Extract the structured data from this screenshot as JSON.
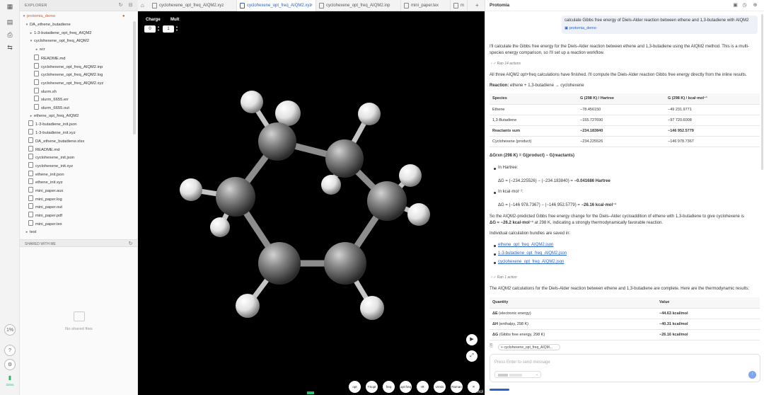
{
  "rail": {
    "progress_label": "1%",
    "time_label": "22ms"
  },
  "explorer": {
    "title": "EXPLORER",
    "root": "protomia_demo",
    "items": [
      {
        "label": "DA_ethene_butadiene",
        "depth": 1,
        "kind": "folder-open"
      },
      {
        "label": "1-3-butadiene_opt_freq_AIQM2",
        "depth": 2,
        "kind": "folder"
      },
      {
        "label": "cyclohexene_opt_freq_AIQM2",
        "depth": 2,
        "kind": "folder-open"
      },
      {
        "label": "scr",
        "depth": 3,
        "kind": "folder"
      },
      {
        "label": "README.md",
        "depth": 3,
        "kind": "file"
      },
      {
        "label": "cyclohexene_opt_freq_AIQM2.inp",
        "depth": 3,
        "kind": "file"
      },
      {
        "label": "cyclohexene_opt_freq_AIQM2.log",
        "depth": 3,
        "kind": "file"
      },
      {
        "label": "cyclohexene_opt_freq_AIQM2.xyz",
        "depth": 3,
        "kind": "file"
      },
      {
        "label": "slurm.sh",
        "depth": 3,
        "kind": "file"
      },
      {
        "label": "slurm_6655.err",
        "depth": 3,
        "kind": "file"
      },
      {
        "label": "slurm_6655.out",
        "depth": 3,
        "kind": "file"
      },
      {
        "label": "ethene_opt_freq_AIQM2",
        "depth": 2,
        "kind": "folder"
      },
      {
        "label": "1-3-butadiene_init.json",
        "depth": 2,
        "kind": "file"
      },
      {
        "label": "1-3-butadiene_init.xyz",
        "depth": 2,
        "kind": "file"
      },
      {
        "label": "DA_ethene_butadiene.xlsx",
        "depth": 2,
        "kind": "file"
      },
      {
        "label": "README.md",
        "depth": 2,
        "kind": "file"
      },
      {
        "label": "cyclohexene_init.json",
        "depth": 2,
        "kind": "file"
      },
      {
        "label": "cyclohexene_init.xyz",
        "depth": 2,
        "kind": "file"
      },
      {
        "label": "ethene_init.json",
        "depth": 2,
        "kind": "file"
      },
      {
        "label": "ethene_init.xyz",
        "depth": 2,
        "kind": "file"
      },
      {
        "label": "mini_paper.aux",
        "depth": 2,
        "kind": "file"
      },
      {
        "label": "mini_paper.log",
        "depth": 2,
        "kind": "file"
      },
      {
        "label": "mini_paper.out",
        "depth": 2,
        "kind": "file"
      },
      {
        "label": "mini_paper.pdf",
        "depth": 2,
        "kind": "file"
      },
      {
        "label": "mini_paper.tex",
        "depth": 2,
        "kind": "file"
      },
      {
        "label": "test",
        "depth": 1,
        "kind": "folder"
      }
    ],
    "shared_title": "SHARED WITH ME",
    "no_shared": "No shared files"
  },
  "tabs": [
    {
      "label": "cyclohexene_opt_freq_AIQM2.xyz",
      "active": false
    },
    {
      "label": "cyclohexene_opt_freq_AIQM2.xyz",
      "active": true
    },
    {
      "label": "cyclohexene_opt_freq_AIQM2.inp",
      "active": false
    },
    {
      "label": "mini_paper.tex",
      "active": false
    },
    {
      "label": "m",
      "active": false
    }
  ],
  "viewer": {
    "charge_label": "Charge",
    "charge_value": "0",
    "mult_label": "Mult",
    "mult_value": "1",
    "buttons": [
      "opt",
      "TSopt",
      "freq",
      "opt freq",
      "IR",
      "UVvis",
      "Raman"
    ],
    "jsmol": "JSmol"
  },
  "chat": {
    "title": "Protomia",
    "user_message": "calculate Gibbs free energy of Diels-Alder reaction between ethene and 1,3-butadiene with AIQM2",
    "user_tag": "protomia_demo",
    "intro": "I'll calculate the Gibbs free energy for the Diels-Alder reaction between ethene and 1,3-butadiene using the AIQM2 method. This is a multi-species energy comparison, so I'll set up a reaction workflow.",
    "ran_actions_1": "Ran 14 actions",
    "finished": "All three AIQM2 opt+freq calculations have finished. I'll compute the Diels-Alder reaction Gibbs free energy directly from the inline results.",
    "reaction_label": "Reaction:",
    "reaction_text": "ethene + 1,3-butadiene → cyclohexene",
    "table1": {
      "headers": [
        "Species",
        "G (298 K) / Hartree",
        "G (298 K) / kcal·mol⁻¹"
      ],
      "rows": [
        {
          "c": [
            "Ethene",
            "−78.456150",
            "−49 231.9771"
          ],
          "bold": false
        },
        {
          "c": [
            "1,3-Butadiene",
            "−155.727690",
            "−97 720.6008"
          ],
          "bold": false
        },
        {
          "c": [
            "Reactants sum",
            "−234.183840",
            "−146 952.5779"
          ],
          "bold": true
        },
        {
          "c": [
            "Cyclohexene (product)",
            "−234.225526",
            "−146 978.7367"
          ],
          "bold": false
        }
      ]
    },
    "dg_formula": "ΔGrxn (298 K) = G(product) − G(reactants)",
    "in_hartree": "In Hartree:",
    "hartree_eq_a": "ΔG = (−234.225526) − (−234.183840) = ",
    "hartree_eq_b": "−0.041686 Hartree",
    "in_kcal": "In kcal·mol⁻¹:",
    "kcal_eq_a": "ΔG = (−146 978.7367) − (−146 952.5779) = ",
    "kcal_eq_b": "−26.16 kcal·mol⁻¹",
    "summary_1": "So the AIQM2-predicted Gibbs free energy change for the Diels–Alder cycloaddition of ethene with 1,3-butadiene to give cyclohexene is",
    "summary_2a": "ΔG ≈ −26.2 kcal·mol⁻¹",
    "summary_2b": " at 298 K, indicating a strongly thermodynamically favorable reaction.",
    "bundles_intro": "Individual calculation bundles are saved in:",
    "links": [
      "ethene_opt_freq_AIQM2.json",
      "1-3-butadiene_opt_freq_AIQM2.json",
      "cyclohexene_opt_freq_AIQM2.json"
    ],
    "ran_actions_2": "Ran 1 action",
    "complete": "The AIQM2 calculations for the Diels-Alder reaction between ethene and 1,3-butadiene are complete. Here are the thermodynamic results:",
    "table2": {
      "headers": [
        "Quantity",
        "Value"
      ],
      "rows": [
        {
          "q": "ΔE",
          "d": " (electronic energy)",
          "v": "−44.63 kcal/mol"
        },
        {
          "q": "ΔH",
          "d": " (enthalpy, 298 K)",
          "v": "−40.31 kcal/mol"
        },
        {
          "q": "ΔG",
          "d": " (Gibbs free energy, 298 K)",
          "v": "−26.16 kcal/mol"
        }
      ]
    },
    "context_chip": "cyclohexene_opt_freq_AIQM...",
    "input_placeholder": "Press Enter to send message"
  }
}
